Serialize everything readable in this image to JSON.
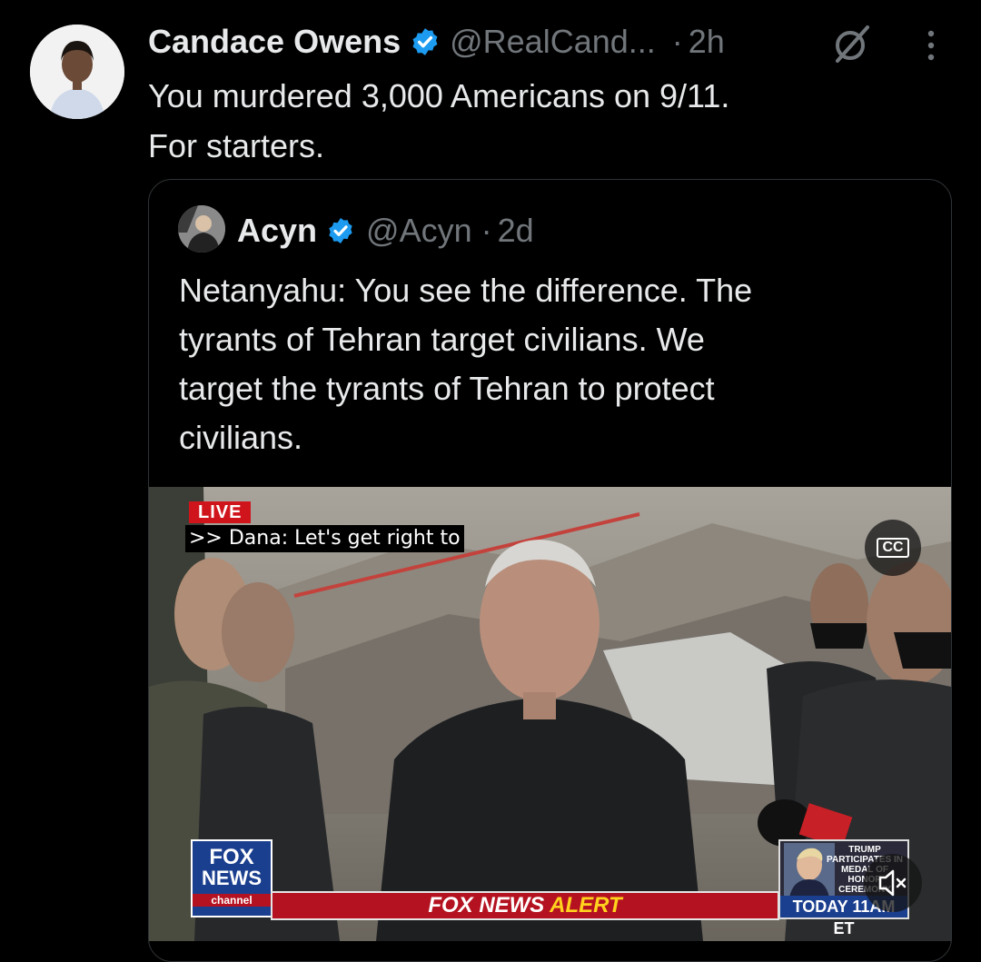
{
  "tweet": {
    "author_name": "Candace Owens",
    "author_handle": "@RealCand...",
    "separator": "·",
    "time": "2h",
    "text": "You murdered 3,000 Americans on 9/11.\nFor starters."
  },
  "quoted_tweet": {
    "author_name": "Acyn",
    "author_handle": "@Acyn",
    "separator": "·",
    "time": "2d",
    "text": "Netanyahu: You see the difference. The\ntyrants of Tehran target civilians. We\ntarget the tyrants of Tehran to protect\ncivilians."
  },
  "video": {
    "live_badge": "LIVE",
    "caption": ">> Dana: Let's get right to",
    "cc_label": "CC",
    "fox_logo_line1": "FOX",
    "fox_logo_line2": "NEWS",
    "fox_logo_line3": "channel",
    "alert_part1": "FOX NEWS",
    "alert_part2": "ALERT",
    "promo_text": "TRUMP PARTICIPATES IN MEDAL OF HONOR CEREMONY",
    "promo_time": "TODAY 11AM ET"
  },
  "colors": {
    "background": "#000000",
    "verified_blue": "#1d9bf0",
    "secondary_text": "#71767b"
  },
  "icons": {
    "verified": "verified-badge-icon",
    "grok": "grok-icon",
    "more": "more-options-icon",
    "mute": "muted-speaker-icon"
  }
}
